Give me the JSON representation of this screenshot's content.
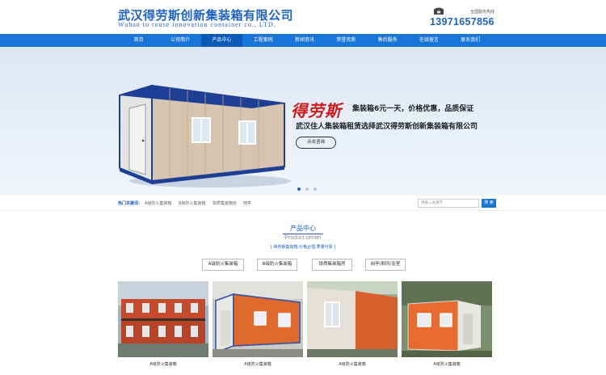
{
  "header": {
    "company_cn": "武汉得劳斯创新集装箱有限公司",
    "company_en": "Wuhan to rouse innovation container co., LTD.",
    "hotline_caption": "全国服务热线",
    "hotline_number": "13971657856"
  },
  "nav": {
    "items": [
      {
        "label": "首页"
      },
      {
        "label": "公司简介"
      },
      {
        "label": "产品中心"
      },
      {
        "label": "工程案例"
      },
      {
        "label": "新闻资讯"
      },
      {
        "label": "荣誉资质"
      },
      {
        "label": "售后服务"
      },
      {
        "label": "在线留言"
      },
      {
        "label": "联系我们"
      }
    ],
    "active_index": 2
  },
  "banner": {
    "brand_script": "得劳斯",
    "slogan": "集装箱6元一天，价格优惠，品质保证",
    "subtitle": "武汉住人集装箱租赁选择武汉得劳斯创新集装箱有限公司",
    "button_label": "点击咨询",
    "slides_total": 3,
    "active_slide": 1
  },
  "keywords": {
    "label": "热门关键词：",
    "items": [
      "A级防火集装箱",
      "B级防火集装箱",
      "铁质集装箱房",
      "岗亭"
    ],
    "search_placeholder": "请输入关键字",
    "search_button": "搜 索"
  },
  "product_center": {
    "title": "产品中心",
    "subtitle_en": "Product center",
    "description": "[ 得劳斯集装箱,价格合理,质量可靠 ]",
    "categories": [
      "A级防火集装箱",
      "B级防火集装箱",
      "铁质集装箱房",
      "岗亭/厕所/浴室"
    ],
    "products": [
      {
        "caption": "A级防火集装箱"
      },
      {
        "caption": "A级防火集装箱"
      },
      {
        "caption": "A级防火集装箱"
      },
      {
        "caption": "A级防火集装箱"
      }
    ]
  },
  "colors": {
    "brand_blue": "#1e62c8",
    "nav_blue": "#1976d8",
    "accent_red": "#cc1b1b"
  }
}
